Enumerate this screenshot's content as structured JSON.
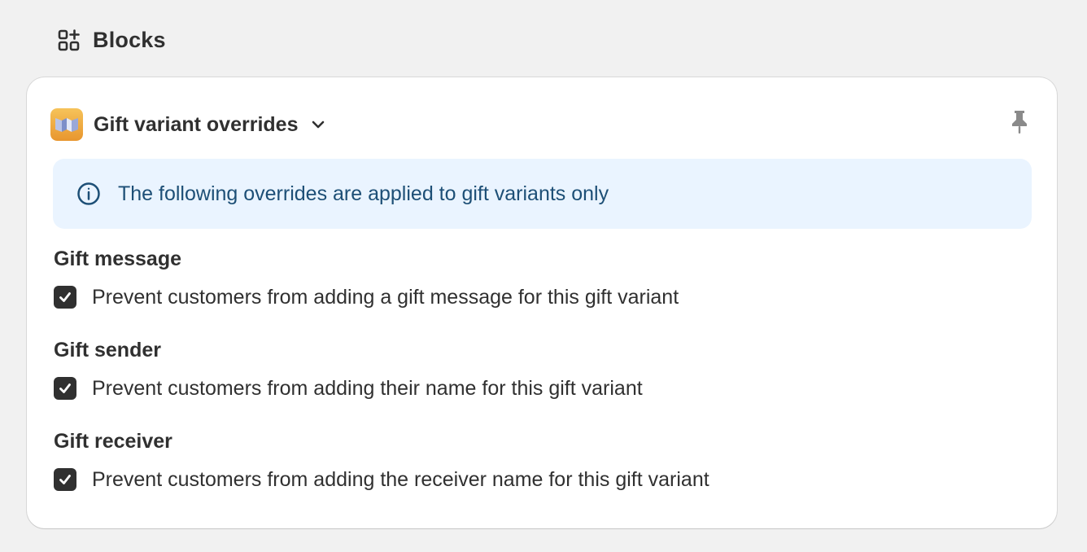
{
  "section": {
    "icon": "blocks-icon",
    "title": "Blocks"
  },
  "block": {
    "logo_icon": "app-logo",
    "title": "Gift variant overrides",
    "expand_icon": "chevron-down-icon",
    "pin_icon": "pin-icon"
  },
  "banner": {
    "icon": "info-icon",
    "text": "The following overrides are applied to gift variants only",
    "background": "#eaf4ff",
    "text_color": "#1d4f76"
  },
  "groups": [
    {
      "label": "Gift message",
      "checkbox_label": "Prevent customers from adding a gift message for this gift variant",
      "checked": true
    },
    {
      "label": "Gift sender",
      "checkbox_label": "Prevent customers from adding their name for this gift variant",
      "checked": true
    },
    {
      "label": "Gift receiver",
      "checkbox_label": "Prevent customers from adding the receiver name for this gift variant",
      "checked": true
    }
  ],
  "colors": {
    "page_background": "#f1f1f1",
    "card_background": "#ffffff",
    "checkbox_checked": "#303030"
  }
}
